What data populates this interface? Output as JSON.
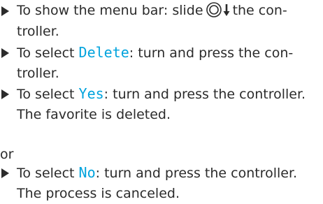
{
  "steps": [
    {
      "line1_prefix": "To show the menu bar: slide",
      "line1_suffix": "the con-",
      "line2": "troller.",
      "controller_icon": "controller-slide-down-icon"
    },
    {
      "line1_prefix": "To select ",
      "term": "Delete",
      "line1_suffix": ": turn and press the con-",
      "line2": "troller."
    },
    {
      "line1_prefix": "To select ",
      "term": "Yes",
      "line1_suffix": ": turn and press the controller.",
      "line2": "The favorite is deleted."
    },
    {
      "line1_prefix": "To select ",
      "term": "No",
      "line1_suffix": ": turn and press the controller.",
      "line2": "The process is canceled."
    }
  ],
  "or_label": "or",
  "colors": {
    "text": "#2b2b2b",
    "menu_term": "#00a3dd"
  }
}
